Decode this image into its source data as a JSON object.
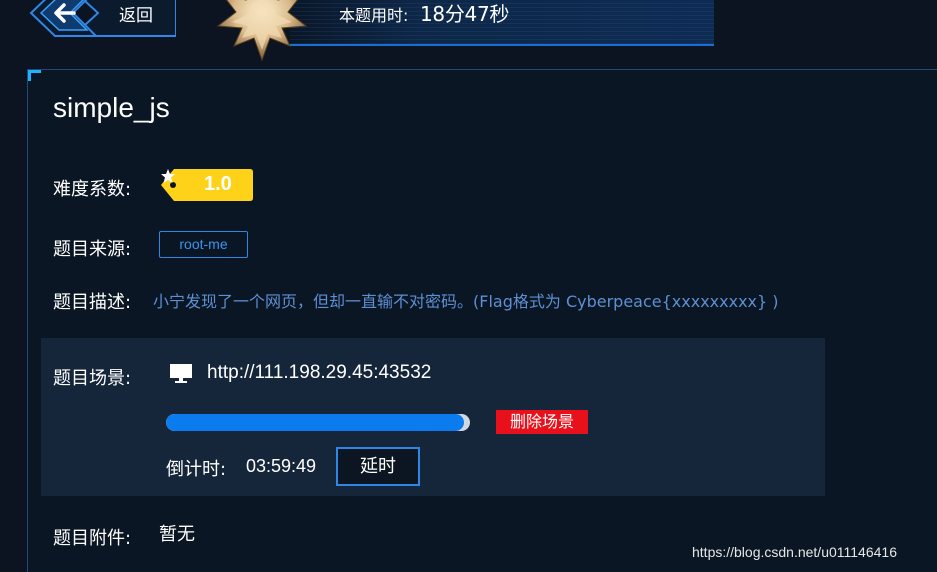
{
  "header": {
    "back_label": "返回",
    "timer_label": "本题用时:",
    "timer_value": "18分47秒"
  },
  "challenge": {
    "title": "simple_js",
    "difficulty_label": "难度系数:",
    "difficulty_value": "1.0",
    "source_label": "题目来源:",
    "source_value": "root-me",
    "description_label": "题目描述:",
    "description_value": "小宁发现了一个网页，但却一直输不对密码。(Flag格式为 Cyberpeace{xxxxxxxxx} )"
  },
  "scene": {
    "label": "题目场景:",
    "url": "http://111.198.29.45:43532",
    "delete_label": "删除场景",
    "progress_percent": 98,
    "countdown_label": "倒计时:",
    "countdown_value": "03:59:49",
    "extend_label": "延时"
  },
  "attachment": {
    "label": "题目附件:",
    "value": "暂无"
  },
  "watermark": "https://blog.csdn.net/u011146416",
  "colors": {
    "background": "#0b1420",
    "scene_box": "#15253a",
    "accent_blue": "#0b7cf0",
    "delete_red": "#e8101a",
    "difficulty_yellow": "#ffd21a",
    "description_blue": "#5e8fd3"
  },
  "icons": {
    "back": "arrow-left-icon",
    "medal": "medal-star-icon",
    "difficulty_star": "star-icon",
    "scene": "monitor-icon"
  }
}
